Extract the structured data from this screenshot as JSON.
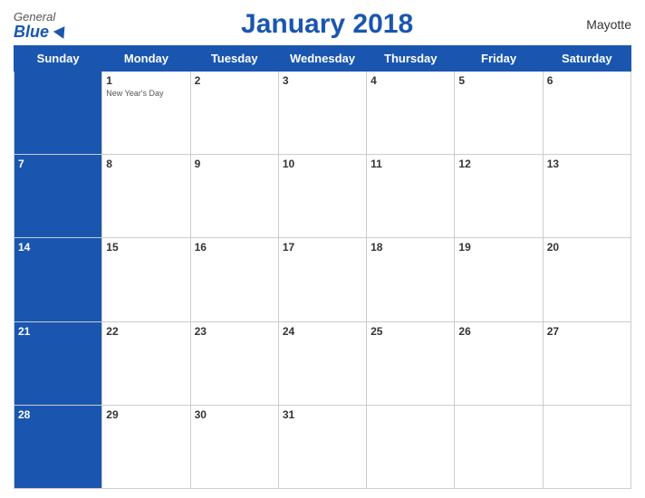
{
  "logo": {
    "general": "General",
    "blue": "Blue"
  },
  "title": "January 2018",
  "region": "Mayotte",
  "days_of_week": [
    "Sunday",
    "Monday",
    "Tuesday",
    "Wednesday",
    "Thursday",
    "Friday",
    "Saturday"
  ],
  "weeks": [
    [
      {
        "day": null,
        "blue": true,
        "event": null
      },
      {
        "day": "1",
        "blue": false,
        "event": "New Year's Day"
      },
      {
        "day": "2",
        "blue": false,
        "event": null
      },
      {
        "day": "3",
        "blue": false,
        "event": null
      },
      {
        "day": "4",
        "blue": false,
        "event": null
      },
      {
        "day": "5",
        "blue": false,
        "event": null
      },
      {
        "day": "6",
        "blue": false,
        "event": null
      }
    ],
    [
      {
        "day": "7",
        "blue": true,
        "event": null
      },
      {
        "day": "8",
        "blue": false,
        "event": null
      },
      {
        "day": "9",
        "blue": false,
        "event": null
      },
      {
        "day": "10",
        "blue": false,
        "event": null
      },
      {
        "day": "11",
        "blue": false,
        "event": null
      },
      {
        "day": "12",
        "blue": false,
        "event": null
      },
      {
        "day": "13",
        "blue": false,
        "event": null
      }
    ],
    [
      {
        "day": "14",
        "blue": true,
        "event": null
      },
      {
        "day": "15",
        "blue": false,
        "event": null
      },
      {
        "day": "16",
        "blue": false,
        "event": null
      },
      {
        "day": "17",
        "blue": false,
        "event": null
      },
      {
        "day": "18",
        "blue": false,
        "event": null
      },
      {
        "day": "19",
        "blue": false,
        "event": null
      },
      {
        "day": "20",
        "blue": false,
        "event": null
      }
    ],
    [
      {
        "day": "21",
        "blue": true,
        "event": null
      },
      {
        "day": "22",
        "blue": false,
        "event": null
      },
      {
        "day": "23",
        "blue": false,
        "event": null
      },
      {
        "day": "24",
        "blue": false,
        "event": null
      },
      {
        "day": "25",
        "blue": false,
        "event": null
      },
      {
        "day": "26",
        "blue": false,
        "event": null
      },
      {
        "day": "27",
        "blue": false,
        "event": null
      }
    ],
    [
      {
        "day": "28",
        "blue": true,
        "event": null
      },
      {
        "day": "29",
        "blue": false,
        "event": null
      },
      {
        "day": "30",
        "blue": false,
        "event": null
      },
      {
        "day": "31",
        "blue": false,
        "event": null
      },
      {
        "day": null,
        "blue": false,
        "event": null
      },
      {
        "day": null,
        "blue": false,
        "event": null
      },
      {
        "day": null,
        "blue": false,
        "event": null
      }
    ]
  ]
}
